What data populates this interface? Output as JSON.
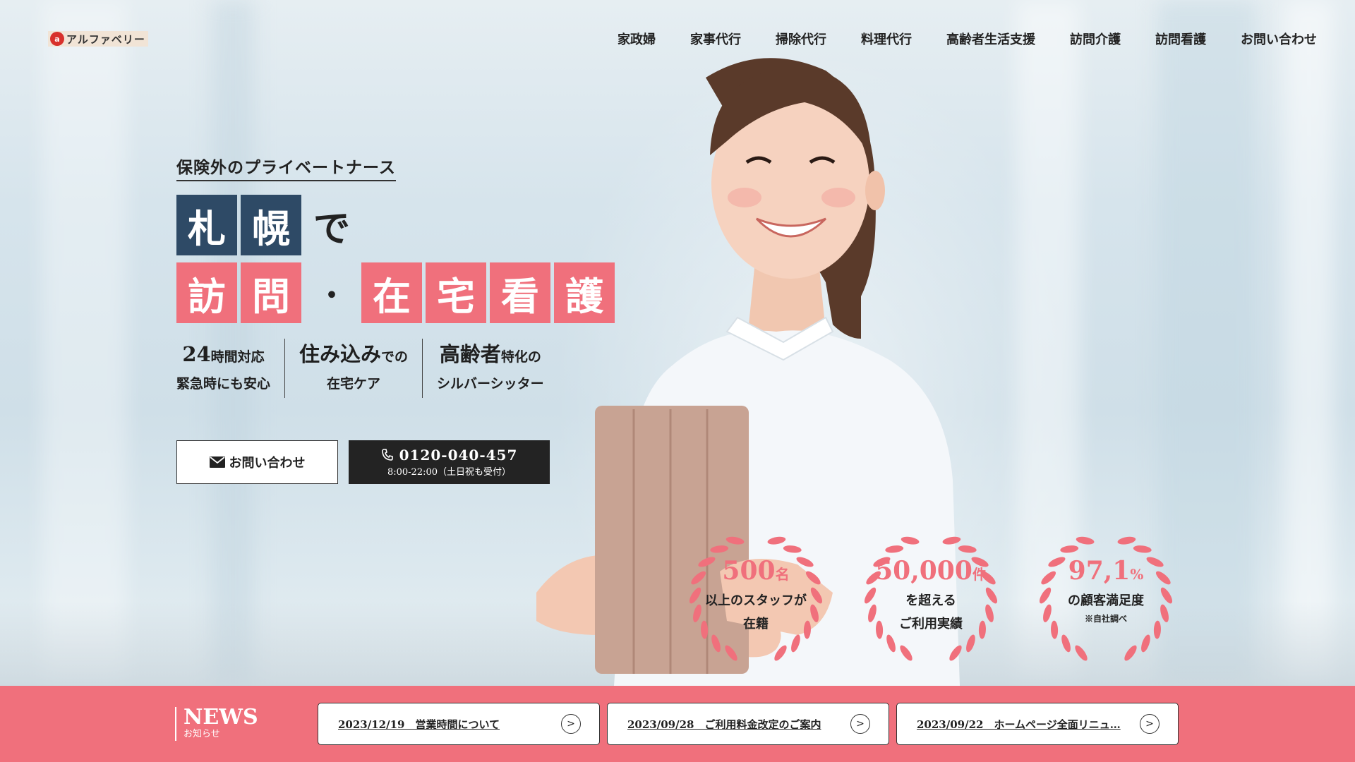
{
  "header": {
    "logo_text": "アルファベリー",
    "nav": [
      "家政婦",
      "家事代行",
      "掃除代行",
      "料理代行",
      "高齢者生活支援",
      "訪問介護",
      "訪問看護",
      "お問い合わせ"
    ]
  },
  "hero": {
    "tagline": "保険外のプライベートナース",
    "headline_row1": [
      "札",
      "幌"
    ],
    "headline_row1_suffix": "で",
    "headline_row2_a": [
      "訪",
      "問"
    ],
    "headline_row2_sep": "・",
    "headline_row2_b": [
      "在",
      "宅",
      "看",
      "護"
    ],
    "features": [
      {
        "num": "24",
        "l1_rest": "時間対応",
        "l2": "緊急時にも安心"
      },
      {
        "l1_big": "住み込み",
        "l1_small": "での",
        "l2": "在宅ケア"
      },
      {
        "l1_big": "高齢者",
        "l1_small": "特化の",
        "l2": "シルバーシッター"
      }
    ],
    "contact_button": "お問い合わせ",
    "phone_number": "0120-040-457",
    "phone_hours": "8:00-22:00（土日祝も受付）"
  },
  "stats": [
    {
      "value": "500",
      "unit": "名",
      "line1": "以上のスタッフが",
      "line2": "在籍"
    },
    {
      "value": "50,000",
      "unit": "件",
      "line1": "を超える",
      "line2": "ご利用実績"
    },
    {
      "value": "97,1",
      "unit": "%",
      "line1": "の顧客満足度",
      "note": "※自社調べ"
    }
  ],
  "news": {
    "title_en": "NEWS",
    "title_jp": "お知らせ",
    "items": [
      {
        "text": "2023/12/19　営業時間について"
      },
      {
        "text": "2023/09/28　ご利用料金改定のご案内"
      },
      {
        "text": "2023/09/22　ホームページ全面リニュ…"
      }
    ]
  },
  "colors": {
    "accent_pink": "#f0707c",
    "navy": "#2e4a66",
    "dark": "#232323"
  }
}
